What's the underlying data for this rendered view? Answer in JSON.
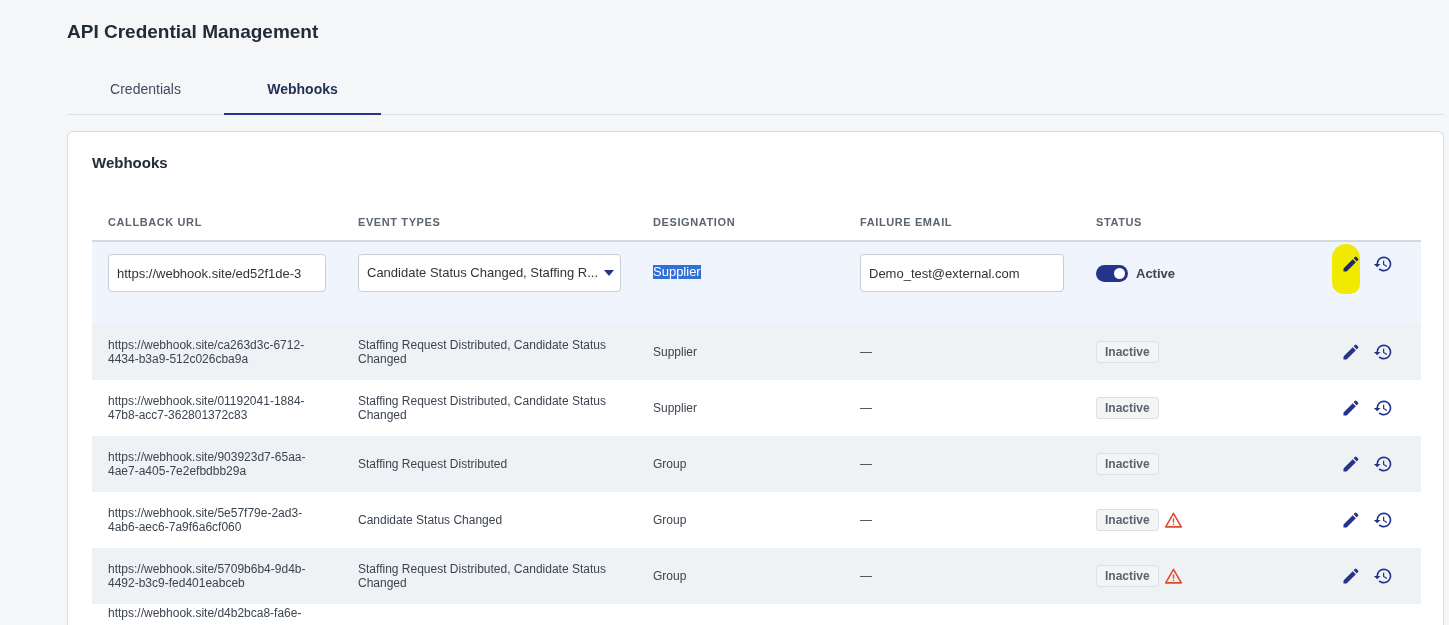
{
  "page_title": "API Credential Management",
  "tabs": [
    {
      "label": "Credentials",
      "selected": false
    },
    {
      "label": "Webhooks",
      "selected": true
    }
  ],
  "card": {
    "title": "Webhooks",
    "columns": [
      "CALLBACK URL",
      "EVENT TYPES",
      "DESIGNATION",
      "FAILURE EMAIL",
      "STATUS"
    ],
    "rows": [
      {
        "kind": "editing",
        "callback_url": "https://webhook.site/ed52f1de-3",
        "event_types": "Candidate Status Changed, Staffing R...",
        "designation": "Supplier",
        "designation_selected": true,
        "failure_email": "Demo_test@external.com",
        "status": {
          "kind": "toggle",
          "on": true,
          "label": "Active"
        },
        "warning": false,
        "edit_highlighted": true
      },
      {
        "kind": "display",
        "callback_url": "https://webhook.site/ca263d3c-6712-4434-b3a9-512c026cba9a",
        "event_types": "Staffing Request Distributed, Candidate Status Changed",
        "designation": "Supplier",
        "failure_email": "—",
        "status": {
          "kind": "badge",
          "label": "Inactive"
        },
        "warning": false,
        "edit_highlighted": false
      },
      {
        "kind": "display",
        "callback_url": "https://webhook.site/01192041-1884-47b8-acc7-362801372c83",
        "event_types": "Staffing Request Distributed, Candidate Status Changed",
        "designation": "Supplier",
        "failure_email": "—",
        "status": {
          "kind": "badge",
          "label": "Inactive"
        },
        "warning": false,
        "edit_highlighted": false
      },
      {
        "kind": "display",
        "callback_url": "https://webhook.site/903923d7-65aa-4ae7-a405-7e2efbdbb29a",
        "event_types": "Staffing Request Distributed",
        "designation": "Group",
        "failure_email": "—",
        "status": {
          "kind": "badge",
          "label": "Inactive"
        },
        "warning": false,
        "edit_highlighted": false
      },
      {
        "kind": "display",
        "callback_url": "https://webhook.site/5e57f79e-2ad3-4ab6-aec6-7a9f6a6cf060",
        "event_types": "Candidate Status Changed",
        "designation": "Group",
        "failure_email": "—",
        "status": {
          "kind": "badge",
          "label": "Inactive"
        },
        "warning": true,
        "edit_highlighted": false
      },
      {
        "kind": "display",
        "callback_url": "https://webhook.site/5709b6b4-9d4b-4492-b3c9-fed401eabceb",
        "event_types": "Staffing Request Distributed, Candidate Status Changed",
        "designation": "Group",
        "failure_email": "—",
        "status": {
          "kind": "badge",
          "label": "Inactive"
        },
        "warning": true,
        "edit_highlighted": false
      },
      {
        "kind": "partial",
        "callback_url": "https://webhook.site/d4b2bca8-fa6e-"
      }
    ]
  }
}
